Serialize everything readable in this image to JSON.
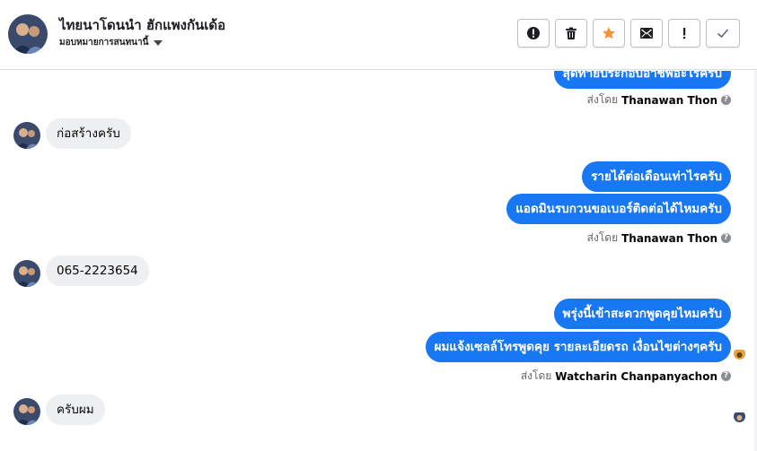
{
  "header": {
    "title": "ไทยนาโดนนำ ฮักแพงกันเด้อ",
    "assign_label": "มอบหมายการสนทนานี้",
    "toolbar": [
      {
        "name": "mark-spam-button",
        "icon": "alert-circle-icon"
      },
      {
        "name": "delete-button",
        "icon": "trash-icon"
      },
      {
        "name": "star-button",
        "icon": "star-icon"
      },
      {
        "name": "unread-button",
        "icon": "envelope-icon"
      },
      {
        "name": "follow-up-button",
        "icon": "exclamation-icon"
      },
      {
        "name": "done-button",
        "icon": "checkmark-icon"
      }
    ]
  },
  "colors": {
    "accent": "#1877f2",
    "star": "#f7923b",
    "incoming_bubble": "#eeeff1"
  },
  "messages": [
    {
      "dir": "out",
      "text": "สุดท้ายประกอบอาชีพอะไรครับ"
    },
    {
      "dir": "meta",
      "prefix": "ส่งโดย",
      "name": "Thanawan Thon"
    },
    {
      "dir": "in",
      "text": "ก่อสร้างครับ"
    },
    {
      "dir": "out",
      "text": "รายได้ต่อเดือนเท่าไรครับ"
    },
    {
      "dir": "out",
      "text": "แอดมินรบกวนขอเบอร์ติดต่อได้ไหมครับ"
    },
    {
      "dir": "meta",
      "prefix": "ส่งโดย",
      "name": "Thanawan Thon"
    },
    {
      "dir": "in",
      "text": "065-2223654"
    },
    {
      "dir": "out",
      "text": "พรุ่งนี้เข้าสะดวกพูดคุยไหมครับ"
    },
    {
      "dir": "out",
      "text": "ผมแจ้งเซลล์โทรพูดคุย รายละเอียดรถ เงื่อนไขต่างๆครับ"
    },
    {
      "dir": "meta",
      "prefix": "ส่งโดย",
      "name": "Watcharin Chanpanyachon"
    },
    {
      "dir": "in",
      "text": "ครับผม"
    }
  ]
}
